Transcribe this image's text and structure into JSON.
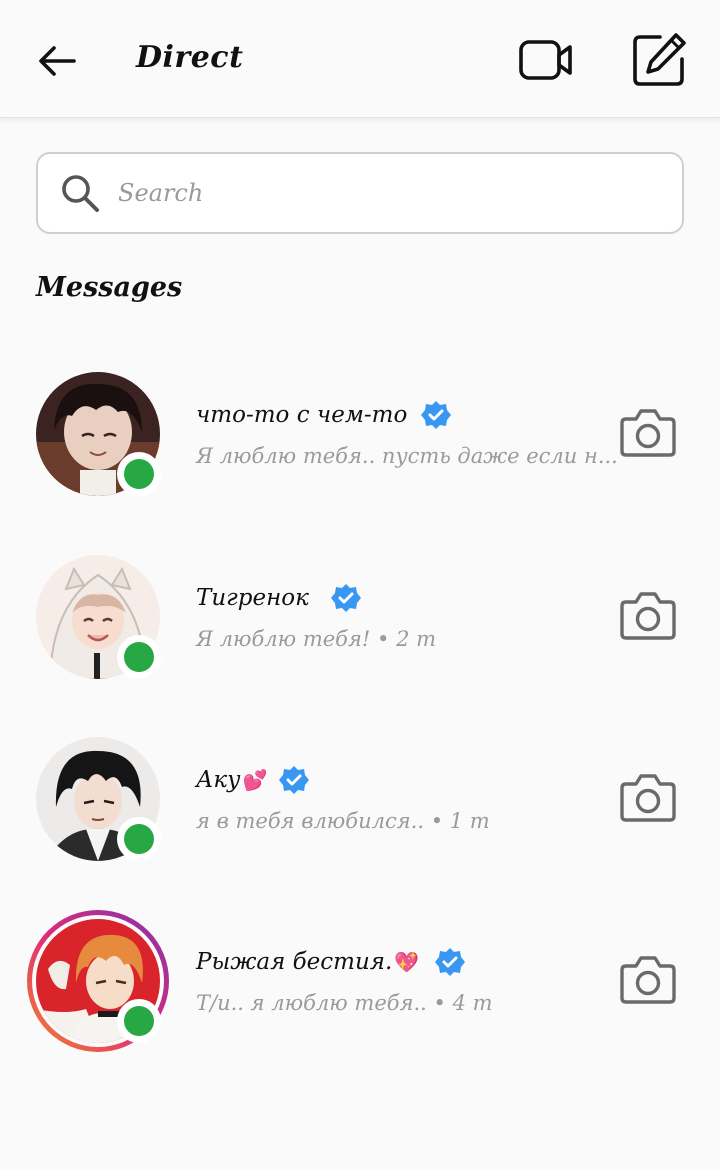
{
  "header": {
    "title": "Direct",
    "back_icon": "arrow-left-icon",
    "video_icon": "video-camera-icon",
    "compose_icon": "compose-icon"
  },
  "search": {
    "placeholder": "Search",
    "icon": "search-icon"
  },
  "section_title": "Messages",
  "colors": {
    "online": "#27a844",
    "verified": "#3897f0",
    "muted": "#9a9a9a"
  },
  "conversations": [
    {
      "name": "что-то с чем-то",
      "emoji": "",
      "verified": true,
      "online": true,
      "story_ring": false,
      "preview": "Я люблю тебя.. пусть даже если н..."
    },
    {
      "name": "Тигренок",
      "emoji": "",
      "verified": true,
      "online": true,
      "story_ring": false,
      "preview": "Я люблю тебя!  • 2 m"
    },
    {
      "name": "Аку",
      "emoji": "💕",
      "verified": true,
      "online": true,
      "story_ring": false,
      "preview": "я в тебя влюбился..  • 1 m"
    },
    {
      "name": "Рыжая бестия.",
      "emoji": "💖",
      "verified": true,
      "online": true,
      "story_ring": true,
      "preview": "Т/и.. я люблю тебя..  • 4 m"
    }
  ]
}
